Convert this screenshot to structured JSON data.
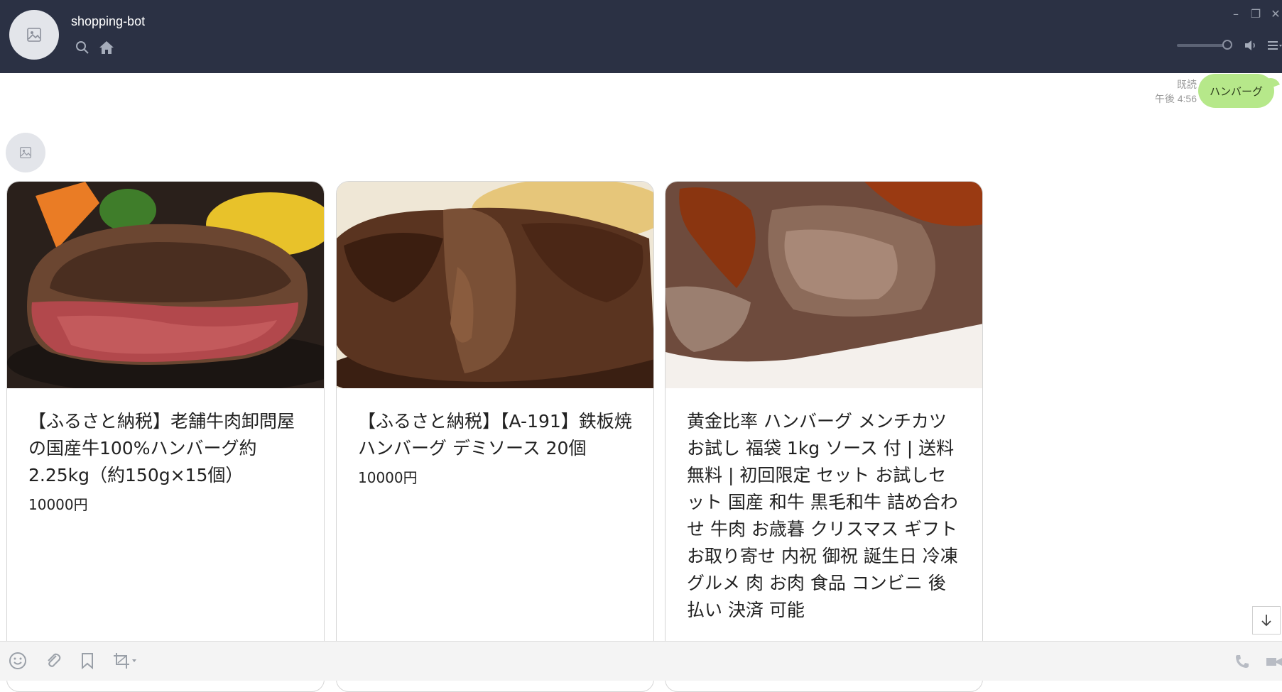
{
  "app": {
    "title": "shopping-bot"
  },
  "header": {
    "icons": [
      "image-placeholder-icon",
      "search-icon",
      "home-icon"
    ],
    "window_controls": [
      "minimize-icon",
      "restore-icon",
      "close-icon"
    ],
    "volume_level": 0.85,
    "right_icons": [
      "speaker-icon",
      "menu-icon"
    ]
  },
  "messages": {
    "outgoing": {
      "read_label": "既読",
      "time": "午後 4:56",
      "text": "ハンバーグ"
    }
  },
  "cards": [
    {
      "title": "【ふるさと納税】老舗牛肉卸問屋の国産牛100%ハンバーグ約2.25kg（約150g×15個）",
      "price": "10000円",
      "image_desc": "grilled-hamburg-steak-cut"
    },
    {
      "title": "【ふるさと納税】【A-191】鉄板焼 ハンバーグ デミソース 20個",
      "price": "10000円",
      "image_desc": "hamburg-demi-sauce"
    },
    {
      "title": "黄金比率 ハンバーグ メンチカツ お試し 福袋 1kg ソース 付 | 送料無料 | 初回限定 セット お試しセット 国産 和牛 黒毛和牛 詰め合わせ 牛肉 お歳暮 クリスマス ギフト お取り寄せ 内祝 御祝 誕生日 冷凍 グルメ 肉 お肉 食品 コンビニ 後払い 決済 可能",
      "price": "",
      "image_desc": "menchikatsu-closeup"
    }
  ],
  "colors": {
    "header_bg": "#2b3144",
    "bubble_bg": "#b6e88a",
    "footer_bg": "#f4f4f4"
  },
  "footer": {
    "icons": [
      "emoji-icon",
      "attach-icon",
      "bookmark-icon",
      "crop-icon",
      "phone-icon",
      "video-icon"
    ]
  }
}
